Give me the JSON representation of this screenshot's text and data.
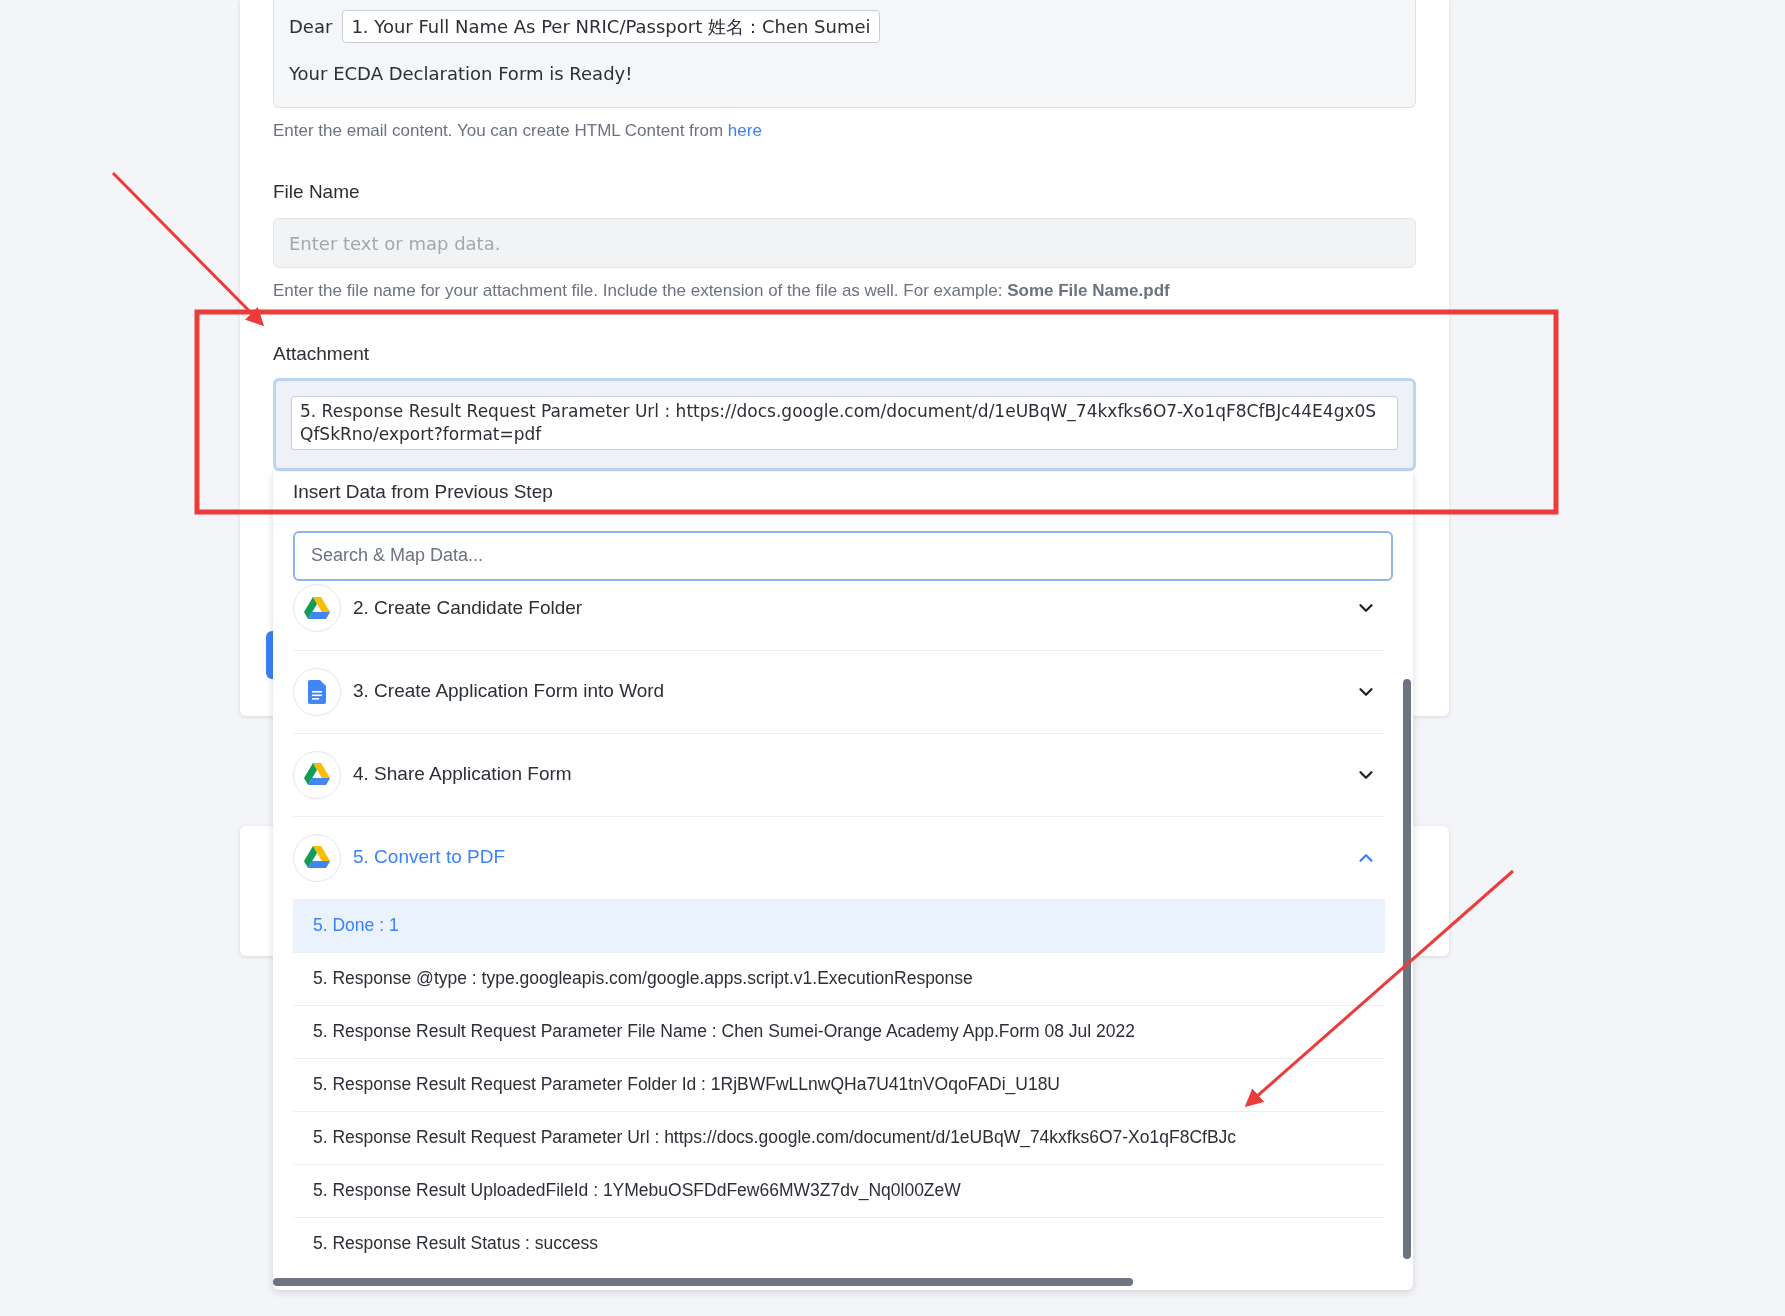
{
  "email_content": {
    "greeting": "Dear",
    "token": "1. Your Full Name As Per NRIC/Passport 姓名：Chen Sumei",
    "body": "Your ECDA Declaration Form is Ready!",
    "help": "Enter the email content. You can create HTML Content from",
    "help_link": "here"
  },
  "file_name": {
    "label": "File Name",
    "placeholder": "Enter text or map data.",
    "help": "Enter the file name for your attachment file. Include the extension of the file as well. For example: **Some File Name.pdf**"
  },
  "attachment": {
    "label": "Attachment",
    "value": "5. Response Result Request Parameter Url : https://docs.google.com/document/d/1eUBqW_74kxfks6O7-Xo1qF8CfBJc44E4gx0SQfSkRno/export?format=pdf"
  },
  "dropdown": {
    "title": "Insert Data from Previous Step",
    "search_placeholder": "Search & Map Data...",
    "steps": [
      {
        "label": "2. Create Candidate Folder",
        "kind": "drive",
        "expanded": false
      },
      {
        "label": "3. Create Application Form into Word",
        "kind": "docs",
        "expanded": false
      },
      {
        "label": "4. Share Application Form",
        "kind": "drive",
        "expanded": false
      },
      {
        "label": "5. Convert to PDF",
        "kind": "drive",
        "expanded": true,
        "items": [
          {
            "text": "5. Done : 1",
            "selected": true
          },
          {
            "text": "5. Response @type : type.googleapis.com/google.apps.script.v1.ExecutionResponse",
            "selected": false
          },
          {
            "text": "5. Response Result Request Parameter File Name : Chen Sumei-Orange Academy App.Form 08 Jul 2022",
            "selected": false
          },
          {
            "text": "5. Response Result Request Parameter Folder Id : 1RjBWFwLLnwQHa7U41tnVOqoFADi_U18U",
            "selected": false
          },
          {
            "text": "5. Response Result Request Parameter Url : https://docs.google.com/document/d/1eUBqW_74kxfks6O7-Xo1qF8CfBJc",
            "selected": false
          },
          {
            "text": "5. Response Result UploadedFileId : 1YMebuOSFDdFew66MW3Z7dv_Nq0l00ZeW",
            "selected": false
          },
          {
            "text": "5. Response Result Status : success",
            "selected": false
          }
        ]
      }
    ]
  }
}
